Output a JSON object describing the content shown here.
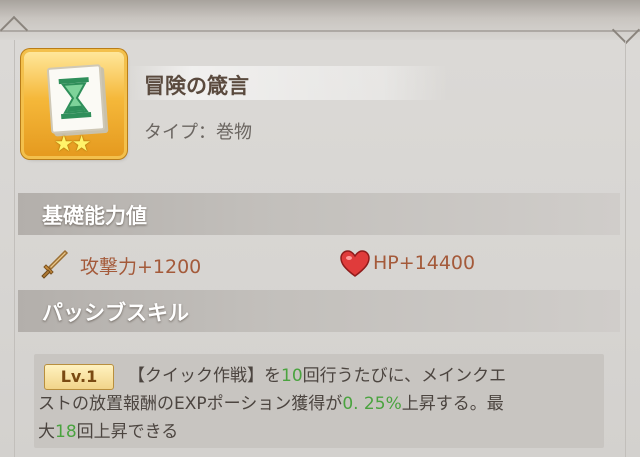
{
  "item": {
    "name": "冒険の箴言",
    "type": "タイプ：巻物",
    "stars": "★★"
  },
  "base_stats": {
    "header": "基礎能力値",
    "attack": "攻撃力+1200",
    "hp": "HP+14400"
  },
  "passive": {
    "header": "パッシブスキル",
    "level": "Lv.1",
    "text_a": "【クイック作戦】を",
    "value_1": "10",
    "text_b": "回行うたびに、メインクエ",
    "text_c": "ストの放置報酬のEXPポーション獲得が",
    "value_2": "0. 25%",
    "text_d": "上昇する。最",
    "text_e": "大",
    "value_3": "18",
    "text_f": "回上昇できる"
  },
  "colors": {
    "highlight": "#4aa33f",
    "stat_text": "#a45a3a",
    "header_text": "#ffffff",
    "icon_frame": "#f3c04c"
  },
  "icons": {
    "item": "hourglass-scroll-icon",
    "attack": "sword-icon",
    "hp": "heart-icon"
  }
}
